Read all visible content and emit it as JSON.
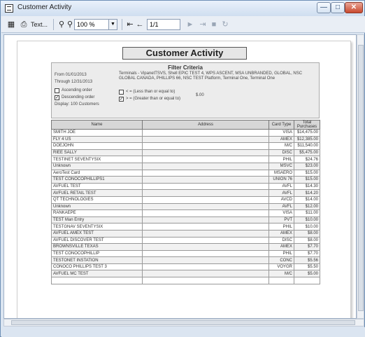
{
  "window": {
    "title": "Customer Activity"
  },
  "toolbar": {
    "find_label": "Text...",
    "zoom": "100 %",
    "page": "1/1"
  },
  "report": {
    "title": "Customer Activity",
    "filter_title": "Filter Criteria",
    "from": "From 01/01/2013",
    "through": "Through 12/31/2013",
    "terminals": "Terminals - VipanetTSVS, Shell EPIC TEST 4, WPS ASCENT, MSA UNBRANDED, GLOBAL, NSC GLOBAL CANADA, PHILLIPS 66, NSC TEST Platform, Terminal One, Terminal One",
    "ascending_label": "Ascending order",
    "descending_label": "Descending order",
    "display_label": "Display: 100 Customers",
    "less_label": "< = (Less than or equal to)",
    "greater_label": "> = (Greater than or equal to)",
    "amount_filter": "$.00",
    "columns": [
      "Name",
      "Address",
      "Card Type",
      "Total Purchases"
    ],
    "rows": [
      {
        "name": "SMITH JOE",
        "address": "",
        "card": "VISA",
        "total": "$14,475.00"
      },
      {
        "name": "FLY 4 US",
        "address": "",
        "card": "AMEX",
        "total": "$12,385.00"
      },
      {
        "name": "DOEJOHN",
        "address": "",
        "card": "M/C",
        "total": "$11,540.00"
      },
      {
        "name": "RIEE SALLY",
        "address": "",
        "card": "DISC",
        "total": "$5,475.00"
      },
      {
        "name": "TESTINET SEVENTYSIX",
        "address": "",
        "card": "PHIL",
        "total": "$24.76"
      },
      {
        "name": "Unknown",
        "address": "",
        "card": "MSVC",
        "total": "$23.00"
      },
      {
        "name": "AeroTest Card",
        "address": "",
        "card": "MSAERO",
        "total": "$15.00"
      },
      {
        "name": "TEST CONOCOPHILLIPS1",
        "address": "",
        "card": "UNION 76",
        "total": "$15.00"
      },
      {
        "name": "AVFUEL TEST",
        "address": "",
        "card": "AVFL",
        "total": "$14.30"
      },
      {
        "name": "AVFUEL RETAIL TEST",
        "address": "",
        "card": "AVFL",
        "total": "$14.20"
      },
      {
        "name": "QT TECHNOLOGIES",
        "address": "",
        "card": "AVCD",
        "total": "$14.00"
      },
      {
        "name": "Unknown",
        "address": "",
        "card": "AVFL",
        "total": "$12.00"
      },
      {
        "name": "RANKAEPE",
        "address": "",
        "card": "VISA",
        "total": "$11.00"
      },
      {
        "name": "TEST Man Entry",
        "address": "",
        "card": "PVT",
        "total": "$10.00"
      },
      {
        "name": "TESTGNAV SEVENTYSIX",
        "address": "",
        "card": "PHIL",
        "total": "$10.00"
      },
      {
        "name": "AVFUEL AMEX TEST",
        "address": "",
        "card": "AMEX",
        "total": "$8.00"
      },
      {
        "name": "AVFUEL DISCOVER TEST",
        "address": "",
        "card": "DISC",
        "total": "$8.00"
      },
      {
        "name": "BROWNSVILLE TEXAS",
        "address": "",
        "card": "AMEX",
        "total": "$7.70"
      },
      {
        "name": "TEST CONOCOPHILLIP",
        "address": "",
        "card": "PHIL",
        "total": "$7.70"
      },
      {
        "name": "TESTONET INSTATION",
        "address": "",
        "card": "CONC",
        "total": "$5.56"
      },
      {
        "name": "CONOCO PHILLIPS TEST 3",
        "address": "",
        "card": "VOYGR",
        "total": "$5.50"
      },
      {
        "name": "AVFUEL MC TEST",
        "address": "",
        "card": "M/C",
        "total": "$5.00"
      },
      {
        "name": "",
        "address": "",
        "card": "",
        "total": ""
      }
    ]
  }
}
